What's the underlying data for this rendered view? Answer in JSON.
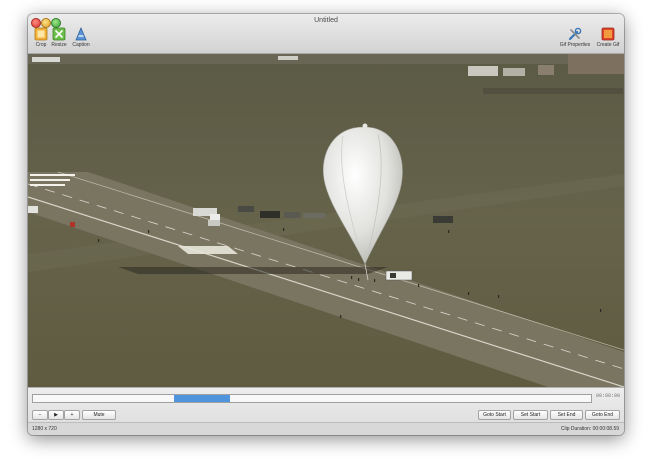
{
  "window": {
    "title": "Untitled"
  },
  "toolbar": {
    "crop_label": "Crop",
    "resize_label": "Resize",
    "caption_label": "Caption",
    "gif_properties_label": "Gif Properties",
    "create_gif_label": "Create Gif"
  },
  "icons": {
    "crop": "crop-icon",
    "resize": "resize-icon",
    "caption": "caption-icon",
    "gif_properties": "tools-icon",
    "create_gif": "create-gif-icon"
  },
  "playback": {
    "minus_label": "−",
    "play_label": "▶",
    "plus_label": "+",
    "mute_label": "Mute",
    "timecode": "00:00:00",
    "selection_start_fraction": 0.253,
    "selection_end_fraction": 0.353,
    "goto_start_label": "Goto Start",
    "set_start_label": "Set Start",
    "set_end_label": "Set End",
    "goto_end_label": "Goto End"
  },
  "status": {
    "resolution": "1280 x 720",
    "clip_duration": "Clip Duration: 00:00:08.59"
  },
  "colors": {
    "accent": "#4f94dc",
    "video_grass": "#5e5d45",
    "runway": "#7d7760",
    "balloon": "#e8e8e8"
  }
}
